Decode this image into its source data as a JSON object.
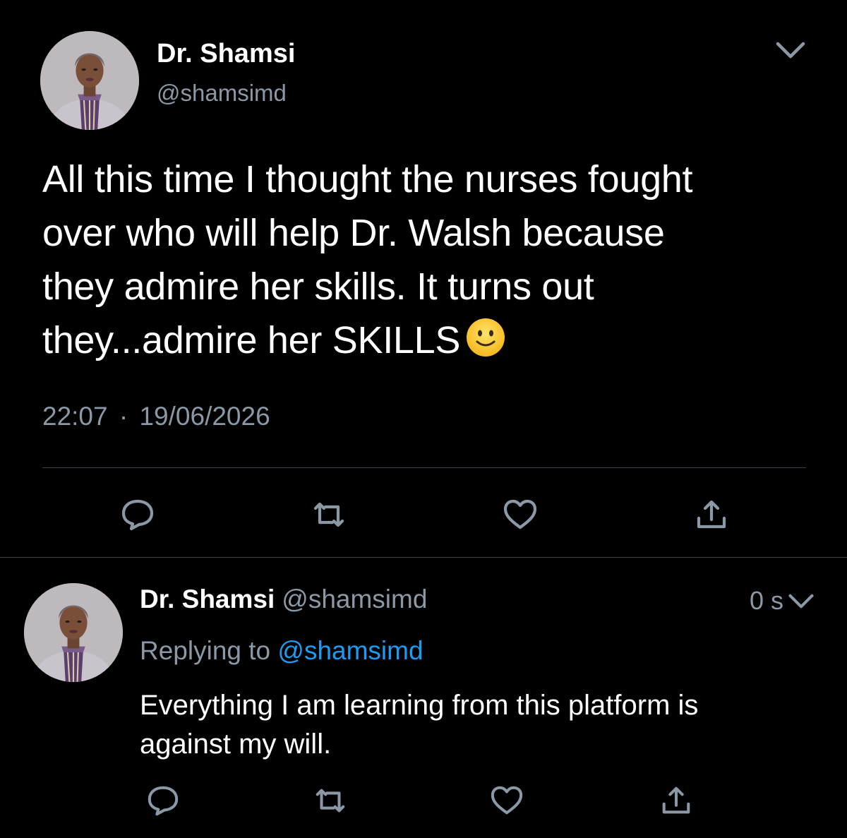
{
  "main_tweet": {
    "author_name": "Dr. Shamsi",
    "handle": "@shamsimd",
    "text_lines": [
      "All this time I thought the nurses fought",
      "over who will help Dr. Walsh because",
      "they admire her skills. It turns out",
      "they...admire her SKILLS"
    ],
    "emoji": "slightly-smiling-face",
    "time": "22:07",
    "separator": "·",
    "date": "19/06/2026",
    "actions": [
      "reply-icon",
      "retweet-icon",
      "like-icon",
      "share-icon"
    ],
    "menu_icon": "chevron-down-icon"
  },
  "reply_tweet": {
    "author_name": "Dr. Shamsi",
    "handle": "@shamsimd",
    "timestamp": "0 s",
    "replying_prefix": "Replying to",
    "replying_to": "@shamsimd",
    "text_lines": [
      "Everything I am learning from this platform is",
      "against my will."
    ],
    "actions": [
      "reply-icon",
      "retweet-icon",
      "like-icon",
      "share-icon"
    ],
    "menu_icon": "chevron-down-icon"
  },
  "colors": {
    "background": "#000000",
    "primary_text": "#ffffff",
    "secondary_text": "#8b98a5",
    "mention": "#1d9bf0",
    "divider": "#38444d"
  }
}
